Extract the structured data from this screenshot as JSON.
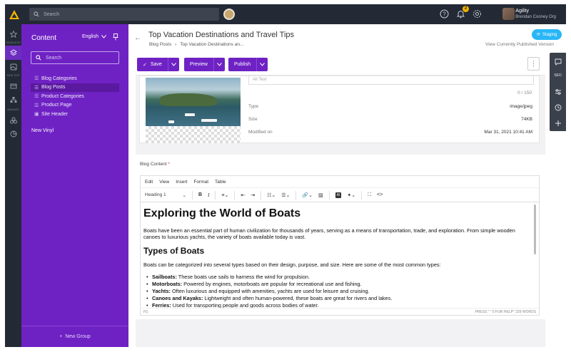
{
  "topbar": {
    "search_placeholder": "Search",
    "notifications_count": "2",
    "user_name": "Agility",
    "org_name": "Brendan Cooney Org"
  },
  "rail": {
    "labels": [
      "HEADLESS",
      "SIDE EXP",
      "MANAGE"
    ]
  },
  "sidebar": {
    "title": "Content",
    "language": "English",
    "search_placeholder": "Search",
    "items": [
      {
        "label": "Blog Categories",
        "icon": "list-icon",
        "active": false
      },
      {
        "label": "Blog Posts",
        "icon": "list-icon",
        "active": true
      },
      {
        "label": "Product Categories",
        "icon": "list-icon",
        "active": false
      },
      {
        "label": "Product Page",
        "icon": "list-icon",
        "active": false
      },
      {
        "label": "Site Header",
        "icon": "item-icon",
        "active": false
      }
    ],
    "group": "New Vinyl",
    "footer_button": "New Group"
  },
  "header": {
    "title": "Top Vacation Destinations and Travel Tips",
    "breadcrumb": [
      "Blog Posts",
      "Top Vacation Destinations an..."
    ],
    "status_badge": "Staging",
    "view_published": "View Currently Published Version"
  },
  "toolbar": {
    "save_label": "Save",
    "preview_label": "Preview",
    "publish_label": "Publish"
  },
  "right_rail": {
    "seo_label": "SEO"
  },
  "image_card": {
    "alt_placeholder": "Alt Text",
    "alt_count": "0 / 150",
    "meta": [
      {
        "key": "Type",
        "value": "image/jpeg"
      },
      {
        "key": "Size",
        "value": "74KB"
      },
      {
        "key": "Modified on",
        "value": "Mar 31, 2021 10:41 AM"
      }
    ]
  },
  "blog_content": {
    "label": "Blog Content",
    "required_mark": "*",
    "menu": [
      "Edit",
      "View",
      "Insert",
      "Format",
      "Table"
    ],
    "block_format": "Heading 1",
    "ai_label": "AI",
    "doc": {
      "h1": "Exploring the World of Boats",
      "p1": "Boats have been an essential part of human civilization for thousands of years, serving as a means of transportation, trade, and exploration. From simple wooden canoes to luxurious yachts, the variety of boats available today is vast.",
      "h2": "Types of Boats",
      "p2": "Boats can be categorized into several types based on their design, purpose, and size. Here are some of the most common types:",
      "list": [
        {
          "term": "Sailboats:",
          "text": " These boats use sails to harness the wind for propulsion."
        },
        {
          "term": "Motorboats:",
          "text": " Powered by engines, motorboats are popular for recreational use and fishing."
        },
        {
          "term": "Yachts:",
          "text": " Often luxurious and equipped with amenities, yachts are used for leisure and cruising."
        },
        {
          "term": "Canoes and Kayaks:",
          "text": " Lightweight and often human-powered, these boats are great for rivers and lakes."
        },
        {
          "term": "Ferries:",
          "text": " Used for transporting people and goods across bodies of water."
        }
      ]
    },
    "status_left": "H1",
    "status_right": "PRESS \"⌃0 FOR HELP\"  229 WORDS"
  }
}
